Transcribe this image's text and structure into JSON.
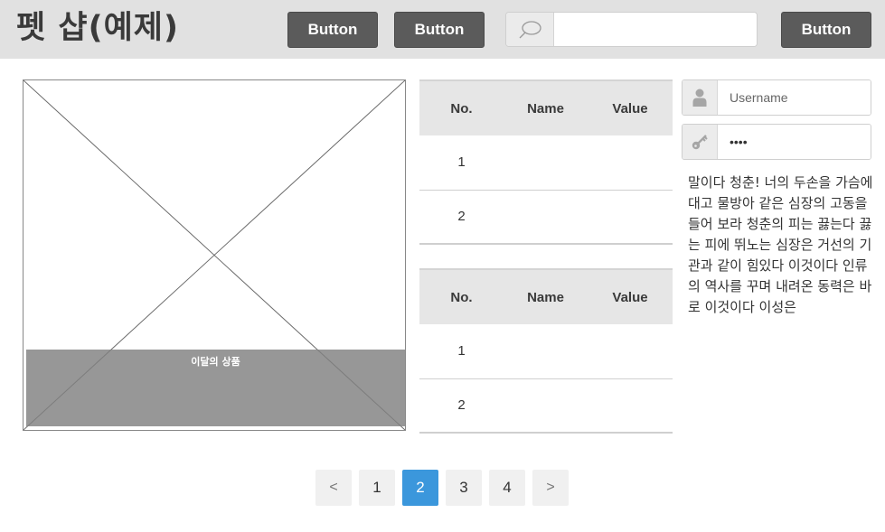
{
  "header": {
    "title": "펫 샵(예제)",
    "buttons": [
      "Button",
      "Button",
      "Button"
    ],
    "search": {
      "value": "",
      "placeholder": "",
      "icon": "search-icon"
    }
  },
  "image": {
    "caption": "이달의 상품"
  },
  "tables": [
    {
      "headers": [
        "No.",
        "Name",
        "Value"
      ],
      "rows": [
        [
          "1",
          "",
          ""
        ],
        [
          "2",
          "",
          ""
        ]
      ]
    },
    {
      "headers": [
        "No.",
        "Name",
        "Value"
      ],
      "rows": [
        [
          "1",
          "",
          ""
        ],
        [
          "2",
          "",
          ""
        ]
      ]
    }
  ],
  "login": {
    "username": {
      "placeholder": "Username",
      "value": "",
      "icon": "user-icon"
    },
    "password": {
      "value": "••••",
      "icon": "key-icon"
    }
  },
  "paragraph": "말이다 청춘! 너의 두손을 가슴에 대고 물방아 같은 심장의 고동을 들어 보라 청춘의 피는 끓는다 끓는 피에 뛰노는 심장은 거선의 기관과 같이 힘있다 이것이다 인류의 역사를 꾸며 내려온 동력은 바로 이것이다 이성은",
  "pagination": {
    "prev": "<",
    "pages": [
      "1",
      "2",
      "3",
      "4"
    ],
    "next": ">",
    "current": "2",
    "accent": "#3b97dc"
  },
  "colors": {
    "header_bg": "#e1e1e1",
    "button_bg": "#5b5b5b",
    "caption_bg": "#808080"
  }
}
